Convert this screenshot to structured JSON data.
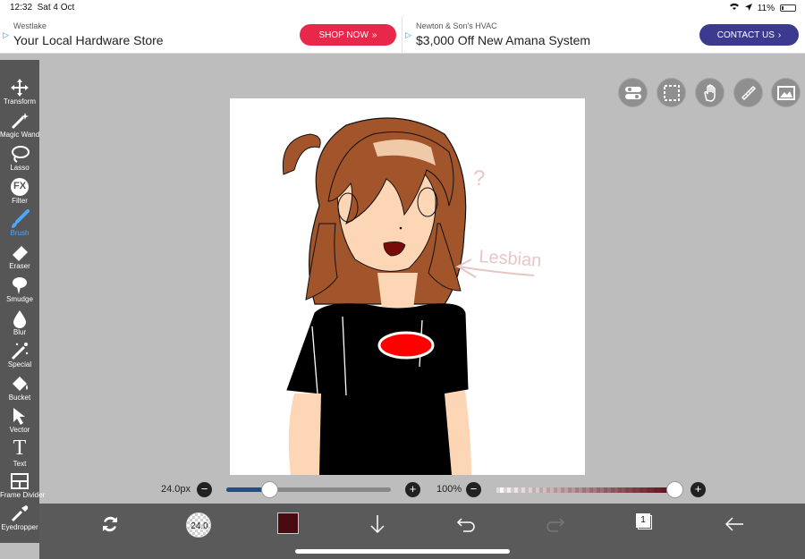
{
  "status_bar": {
    "time": "12:32",
    "date": "Sat 4 Oct",
    "battery": "11%"
  },
  "ads": {
    "left": {
      "brand": "Westlake",
      "headline": "Your Local Hardware Store",
      "button": "SHOP NOW"
    },
    "right": {
      "brand": "Newton & Son's HVAC",
      "headline": "$3,000 Off New Amana System",
      "button": "CONTACT US"
    }
  },
  "tools": [
    {
      "label": "Transform",
      "icon": "move-icon"
    },
    {
      "label": "Magic Wand",
      "icon": "magic-wand-icon"
    },
    {
      "label": "Lasso",
      "icon": "lasso-icon"
    },
    {
      "label": "Filter",
      "icon": "fx-icon",
      "glyph": "FX"
    },
    {
      "label": "Brush",
      "icon": "brush-icon"
    },
    {
      "label": "Eraser",
      "icon": "eraser-icon"
    },
    {
      "label": "Smudge",
      "icon": "smudge-icon"
    },
    {
      "label": "Blur",
      "icon": "blur-drop-icon"
    },
    {
      "label": "Special",
      "icon": "special-icon"
    },
    {
      "label": "Bucket",
      "icon": "bucket-icon"
    },
    {
      "label": "Vector",
      "icon": "vector-arrow-icon"
    },
    {
      "label": "Text",
      "icon": "text-icon",
      "glyph": "T"
    },
    {
      "label": "Frame Divider",
      "icon": "frame-divider-icon"
    },
    {
      "label": "Eyedropper",
      "icon": "eyedropper-icon"
    }
  ],
  "active_tool": "Brush",
  "canvas": {
    "annotation_question": "?",
    "annotation_text": "Lesbian"
  },
  "brush": {
    "size_label": "24.0px",
    "size_fraction": 0.26,
    "preview_label": "24.0"
  },
  "opacity": {
    "label": "100%",
    "fraction": 1.0
  },
  "colors": {
    "current": "#4a0a12",
    "accent": "#4aa8ff",
    "shop_button": "#e8284b",
    "contact_button": "#3b3a8f"
  }
}
